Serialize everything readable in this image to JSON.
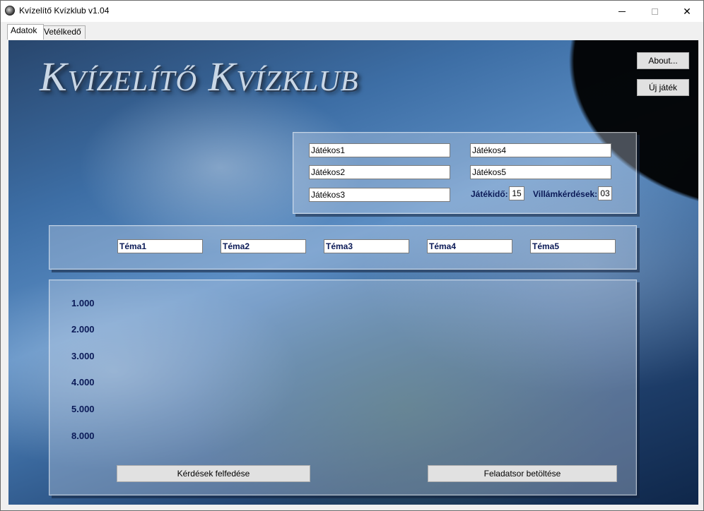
{
  "window": {
    "title": "Kvízelítő Kvízklub v1.04",
    "controls": {
      "minimize": "–",
      "maximize": "□",
      "close": "✕"
    }
  },
  "tabs": [
    {
      "label": "Adatok",
      "active": true
    },
    {
      "label": "Vetélkedő",
      "active": false
    }
  ],
  "banner": {
    "logo_text": "Kvízelítő Kvízklub"
  },
  "buttons": {
    "about": "About...",
    "new_game": "Új játék",
    "reveal_questions": "Kérdések felfedése",
    "load_set": "Feladatsor betöltése"
  },
  "players": [
    "Játékos1",
    "Játékos2",
    "Játékos3",
    "Játékos4",
    "Játékos5"
  ],
  "settings": {
    "time_label": "Játékidő:",
    "time_value": "15",
    "lightning_label": "Villámkérdések:",
    "lightning_value": "03"
  },
  "themes": [
    "Téma1",
    "Téma2",
    "Téma3",
    "Téma4",
    "Téma5"
  ],
  "values": [
    "1.000",
    "2.000",
    "3.000",
    "4.000",
    "5.000",
    "8.000"
  ],
  "colors": {
    "label_text": "#0b1a57",
    "button_bg": "#e1e1e1"
  },
  "icons": {
    "app": "quiz-globe-icon"
  }
}
